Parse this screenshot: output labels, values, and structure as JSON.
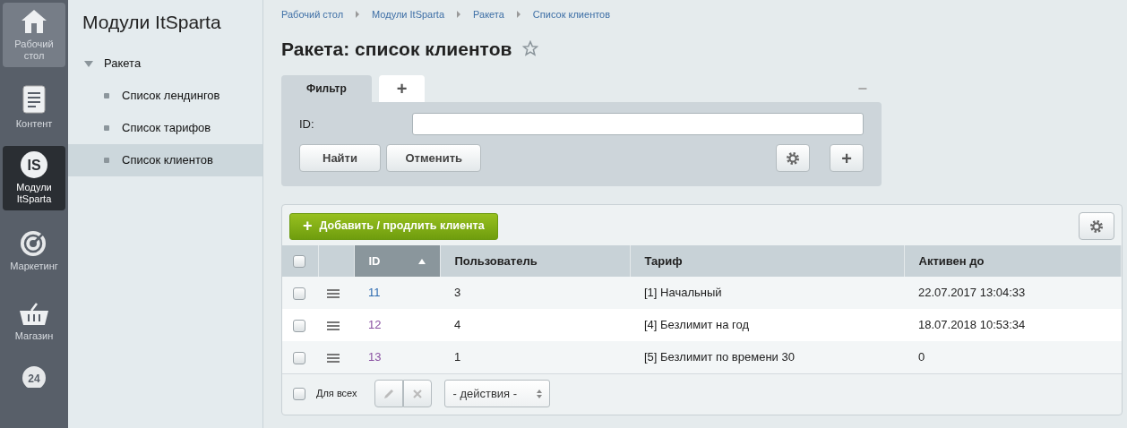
{
  "rail": [
    {
      "label": "Рабочий стол",
      "selected": false
    },
    {
      "label": "Контент",
      "selected": false
    },
    {
      "label": "Модули ItSparta",
      "icon_text": "IS",
      "selected": true
    },
    {
      "label": "Маркетинг",
      "selected": false
    },
    {
      "label": "Магазин",
      "selected": false
    },
    {
      "icon_text": "24"
    }
  ],
  "sidebar": {
    "title": "Модули ItSparta",
    "items": [
      {
        "label": "Ракета",
        "expanded": true,
        "children": [
          {
            "label": "Список лендингов",
            "selected": false
          },
          {
            "label": "Список тарифов",
            "selected": false
          },
          {
            "label": "Список клиентов",
            "selected": true
          }
        ]
      }
    ]
  },
  "breadcrumbs": [
    "Рабочий стол",
    "Модули ItSparta",
    "Ракета",
    "Список клиентов"
  ],
  "title": "Ракета: список клиентов",
  "filter": {
    "tabs": [
      {
        "label": "Фильтр",
        "selected": true
      },
      {
        "label": "+",
        "selected": false
      }
    ],
    "collapse": "−",
    "fields": [
      {
        "label": "ID:"
      }
    ],
    "buttons": [
      "Найти",
      "Отменить"
    ],
    "add_filter": "+"
  },
  "toolbar": {
    "add_button": "Добавить / продлить клиента",
    "add_icon": "+"
  },
  "table": {
    "all_checked": false,
    "columns": [
      {
        "label": "ID",
        "sorted": true
      },
      {
        "label": "Пользователь",
        "sorted": false
      },
      {
        "label": "Тариф",
        "sorted": false
      },
      {
        "label": "Активен до",
        "sorted": false
      }
    ],
    "rows": [
      {
        "checked": false,
        "id": "11",
        "visited": false,
        "user": "3",
        "tariff": "[1] Начальный",
        "active_until": "22.07.2017 13:04:33"
      },
      {
        "checked": false,
        "id": "12",
        "visited": true,
        "user": "4",
        "tariff": "[4] Безлимит на год",
        "active_until": "18.07.2018 10:53:34"
      },
      {
        "checked": false,
        "id": "13",
        "visited": true,
        "user": "1",
        "tariff": "[5] Безлимит по времени 30",
        "active_until": "0"
      }
    ]
  },
  "footer": {
    "for_all": "Для всех",
    "for_all_checked": false,
    "actions": "- действия -"
  }
}
